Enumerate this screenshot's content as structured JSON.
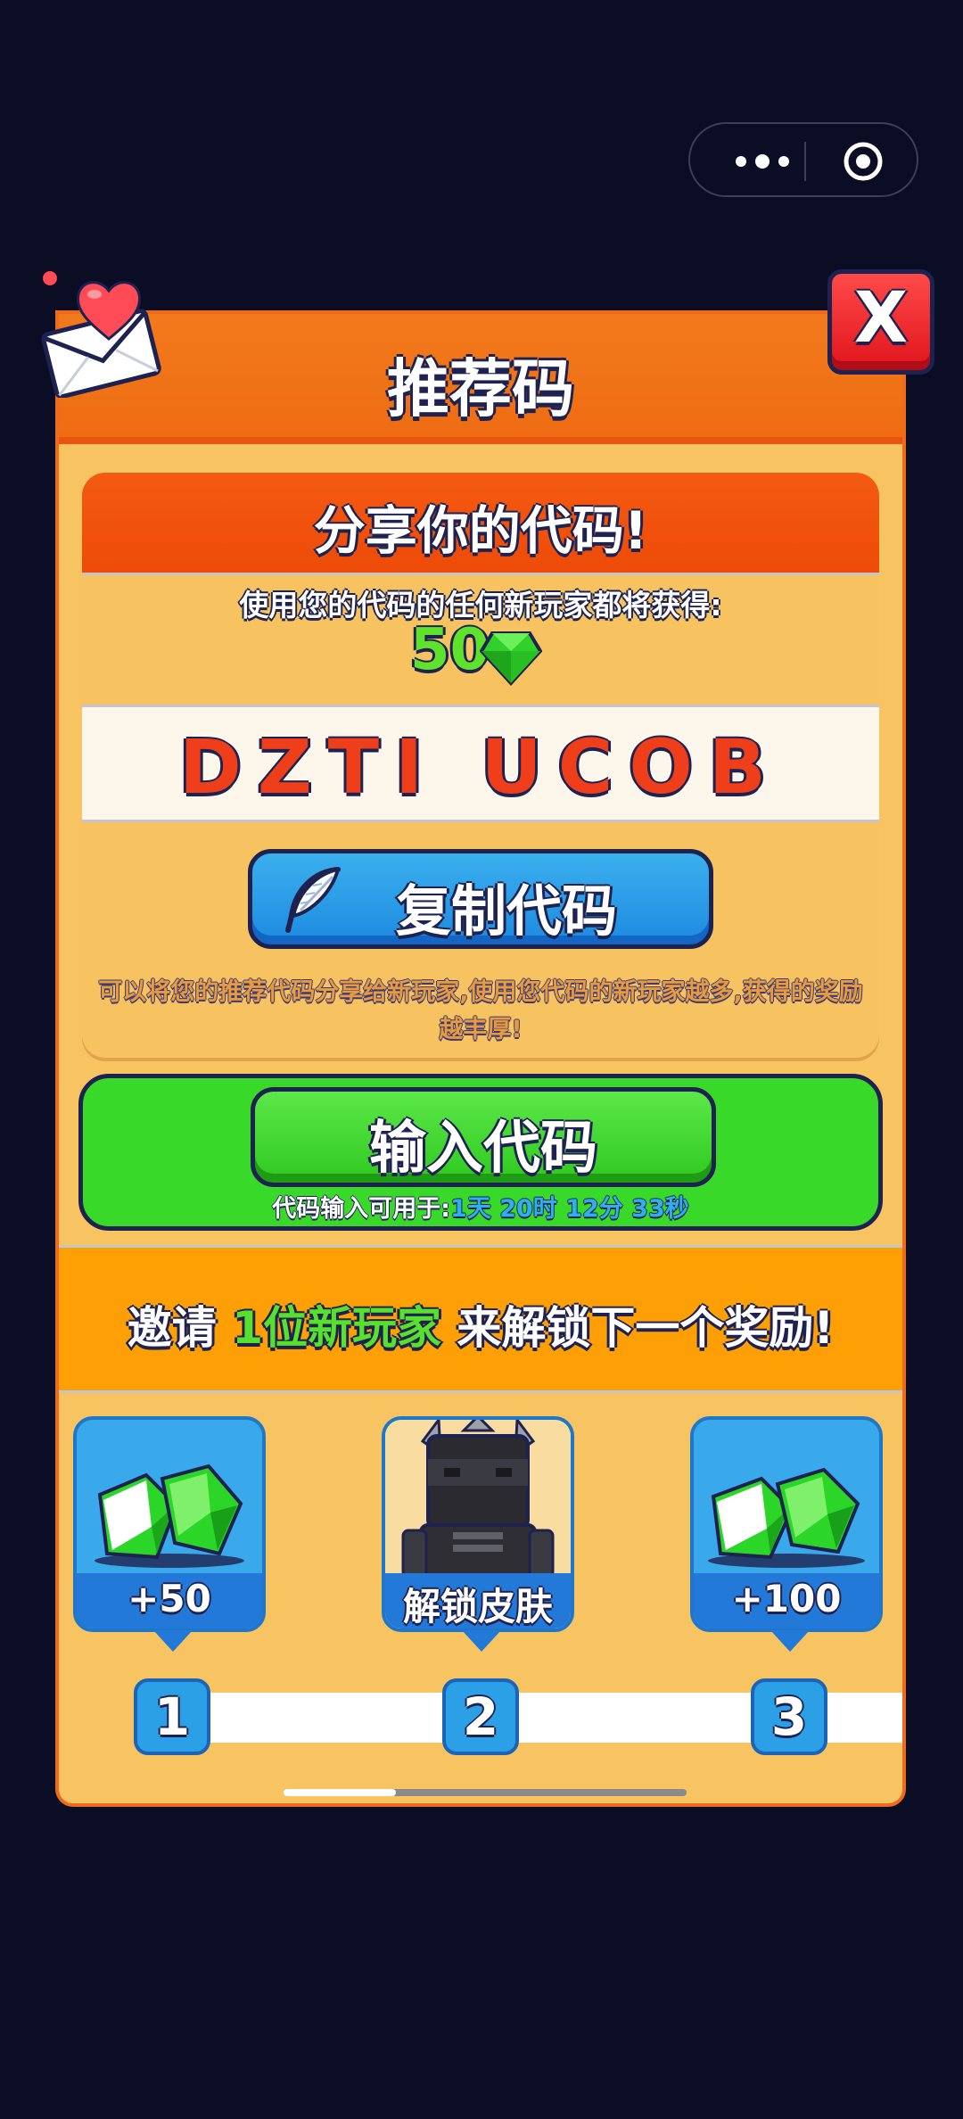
{
  "capsule": {
    "more_icon": "more-dots-icon",
    "target_icon": "target-circle-icon"
  },
  "header": {
    "title": "推荐码"
  },
  "share": {
    "title": "分享你的代码!",
    "reward_desc": "使用您的代码的任何新玩家都将获得:",
    "reward_amount": "50",
    "code": "DZTI UCOB",
    "copy_label": "复制代码",
    "tip": "可以将您的推荐代码分享给新玩家,使用您代码的新玩家越多,获得的奖励越丰厚!"
  },
  "enter": {
    "button_label": "输入代码",
    "available_label": "代码输入可用于:",
    "available_time": "1天 20时 12分 33秒"
  },
  "invite": {
    "prefix": "邀请 ",
    "highlight": "1位新玩家",
    "suffix": " 来解锁下一个奖励!"
  },
  "rewards": [
    {
      "label": "+50",
      "icon": "gem-icon"
    },
    {
      "label": "解锁皮肤",
      "icon": "skin-character-icon"
    },
    {
      "label": "+100",
      "icon": "gem-icon"
    }
  ],
  "steps": [
    "1",
    "2",
    "3"
  ],
  "colors": {
    "panel": "#f8c462",
    "header": "#ef6c13",
    "accent_green": "#39d92a",
    "accent_blue": "#2379d8",
    "code_red": "#ef3f1a",
    "close_red": "#e0141c"
  },
  "close_label": "X"
}
